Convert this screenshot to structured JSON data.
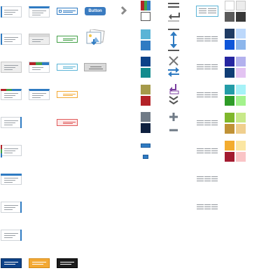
{
  "button_widget": {
    "label": "Button"
  },
  "colors": {
    "blue": "#2f7bc2",
    "teal": "#5ab4d6",
    "navy": "#0d4288",
    "dark_teal": "#138b8d",
    "olive": "#a59a4a",
    "red": "#b32227",
    "slate": "#6f7a86",
    "midnight": "#0e203f",
    "orange": "#f3a934",
    "black": "#1c1c1c",
    "green": "#43a047"
  },
  "palette": [
    [
      "#ffffff",
      "#ececec"
    ],
    [
      "#5a5a5a",
      "#383838"
    ],
    [
      "#1f3b63",
      "#bcd8fb"
    ],
    [
      "#0f56d9",
      "#8cb6ec"
    ],
    [
      "#2626a1",
      "#b3b1ee"
    ],
    [
      "#0f3d75",
      "#e3c3f2"
    ],
    [
      "#239ca7",
      "#a6f2f7"
    ],
    [
      "#2e9b27",
      "#a3f28c"
    ],
    [
      "#7fb72b",
      "#c8e989"
    ],
    [
      "#c09236",
      "#f0cf8e"
    ],
    [
      "#f3ac2f",
      "#fbe6a2"
    ],
    [
      "#a31b30",
      "#fac4c6"
    ]
  ],
  "icons": {
    "chevron": "chevron-right-icon",
    "image": "image-upload-icon",
    "close": "close-icon",
    "swap": "swap-arrows-icon",
    "plus": "plus-icon",
    "minus": "minus-icon"
  }
}
